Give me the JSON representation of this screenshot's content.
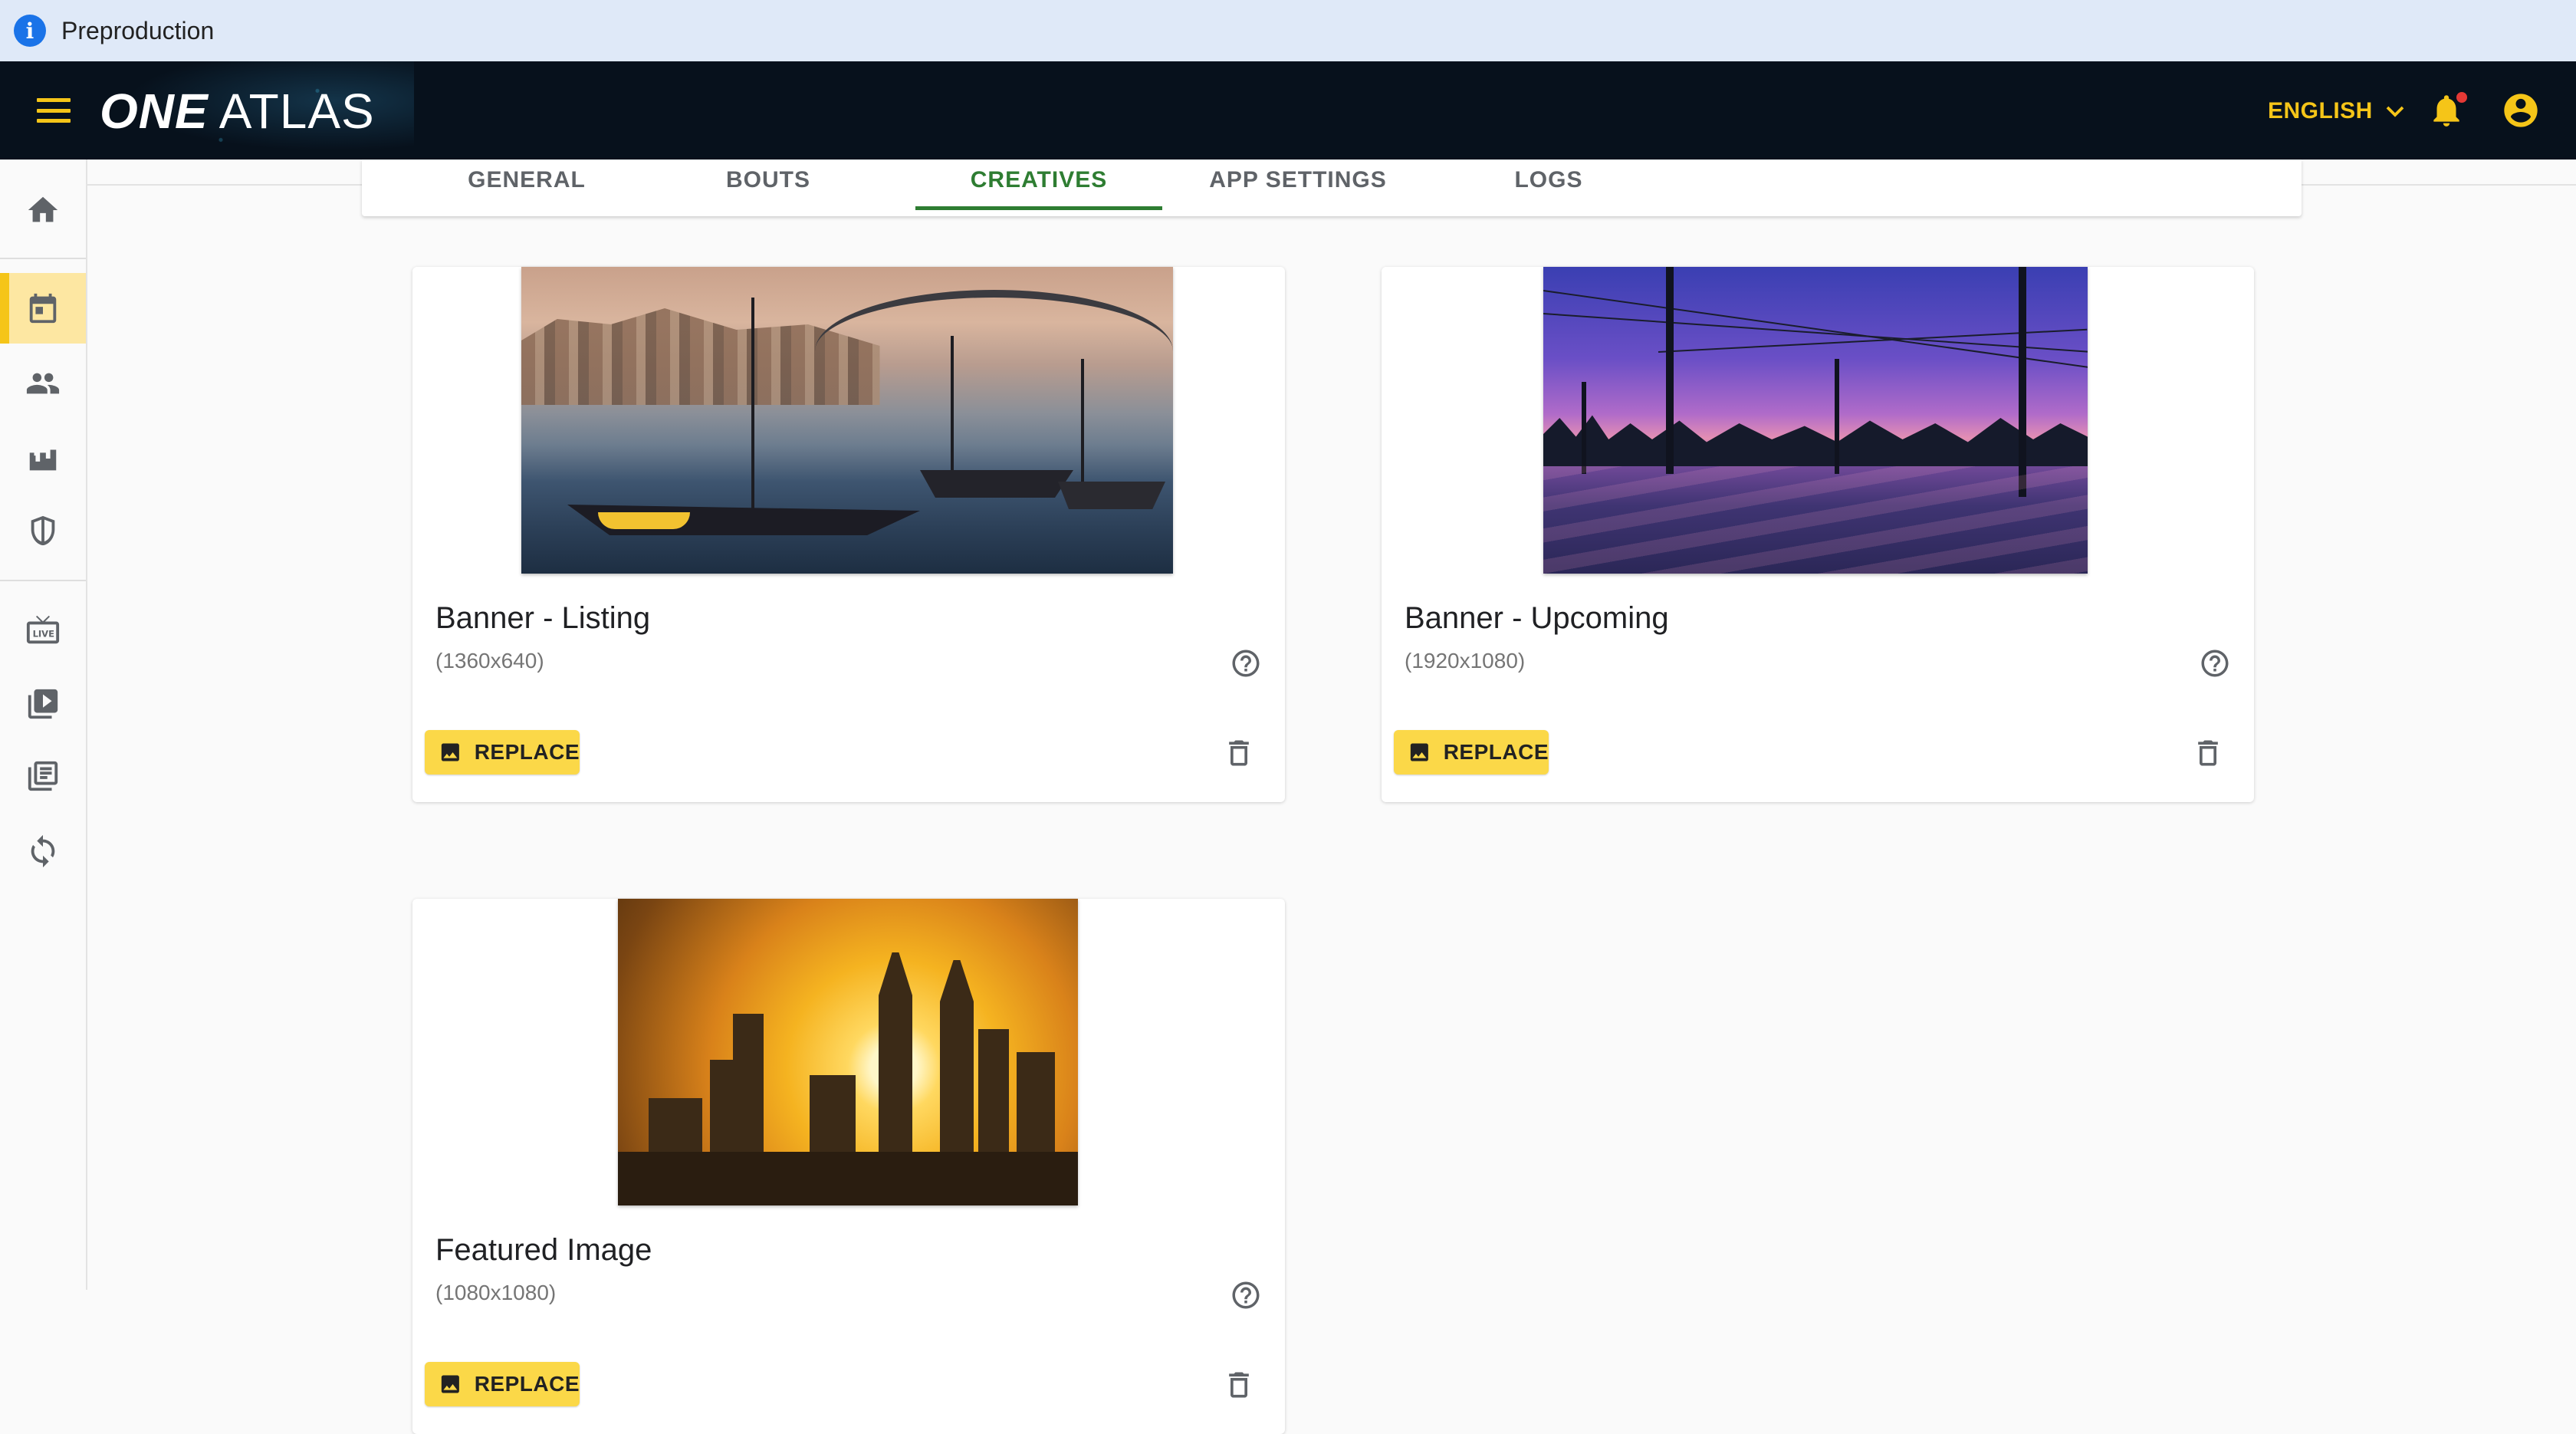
{
  "env_banner": {
    "label": "Preproduction",
    "icon": "info-icon"
  },
  "topbar": {
    "logo_one": "ONE",
    "logo_atlas": "ATLAS",
    "language": "ENGLISH",
    "accent_color": "#f5c518",
    "background_color": "#07111c"
  },
  "sidebar": {
    "items": [
      {
        "name": "home",
        "icon": "home-icon"
      },
      {
        "name": "events",
        "icon": "calendar-icon",
        "active": true
      },
      {
        "name": "people",
        "icon": "people-icon"
      },
      {
        "name": "venues",
        "icon": "stadium-icon"
      },
      {
        "name": "teams",
        "icon": "shield-icon"
      },
      {
        "name": "live",
        "icon": "live-tv-icon"
      },
      {
        "name": "video-library",
        "icon": "video-library-icon"
      },
      {
        "name": "collections",
        "icon": "collections-icon"
      },
      {
        "name": "sync",
        "icon": "sync-icon"
      }
    ]
  },
  "tabs": [
    {
      "label": "GENERAL"
    },
    {
      "label": "BOUTS"
    },
    {
      "label": "CREATIVES",
      "active": true
    },
    {
      "label": "APP SETTINGS"
    },
    {
      "label": "LOGS"
    }
  ],
  "cards": [
    {
      "title": "Banner - Listing",
      "size": "(1360x640)",
      "replace_label": "REPLACE"
    },
    {
      "title": "Banner - Upcoming",
      "size": "(1920x1080)",
      "replace_label": "REPLACE"
    },
    {
      "title": "Featured Image",
      "size": "(1080x1080)",
      "replace_label": "REPLACE"
    }
  ],
  "colors": {
    "replace_button": "#fbd848",
    "active_tab": "#2e7d32",
    "active_nav": "#fde7a2"
  }
}
